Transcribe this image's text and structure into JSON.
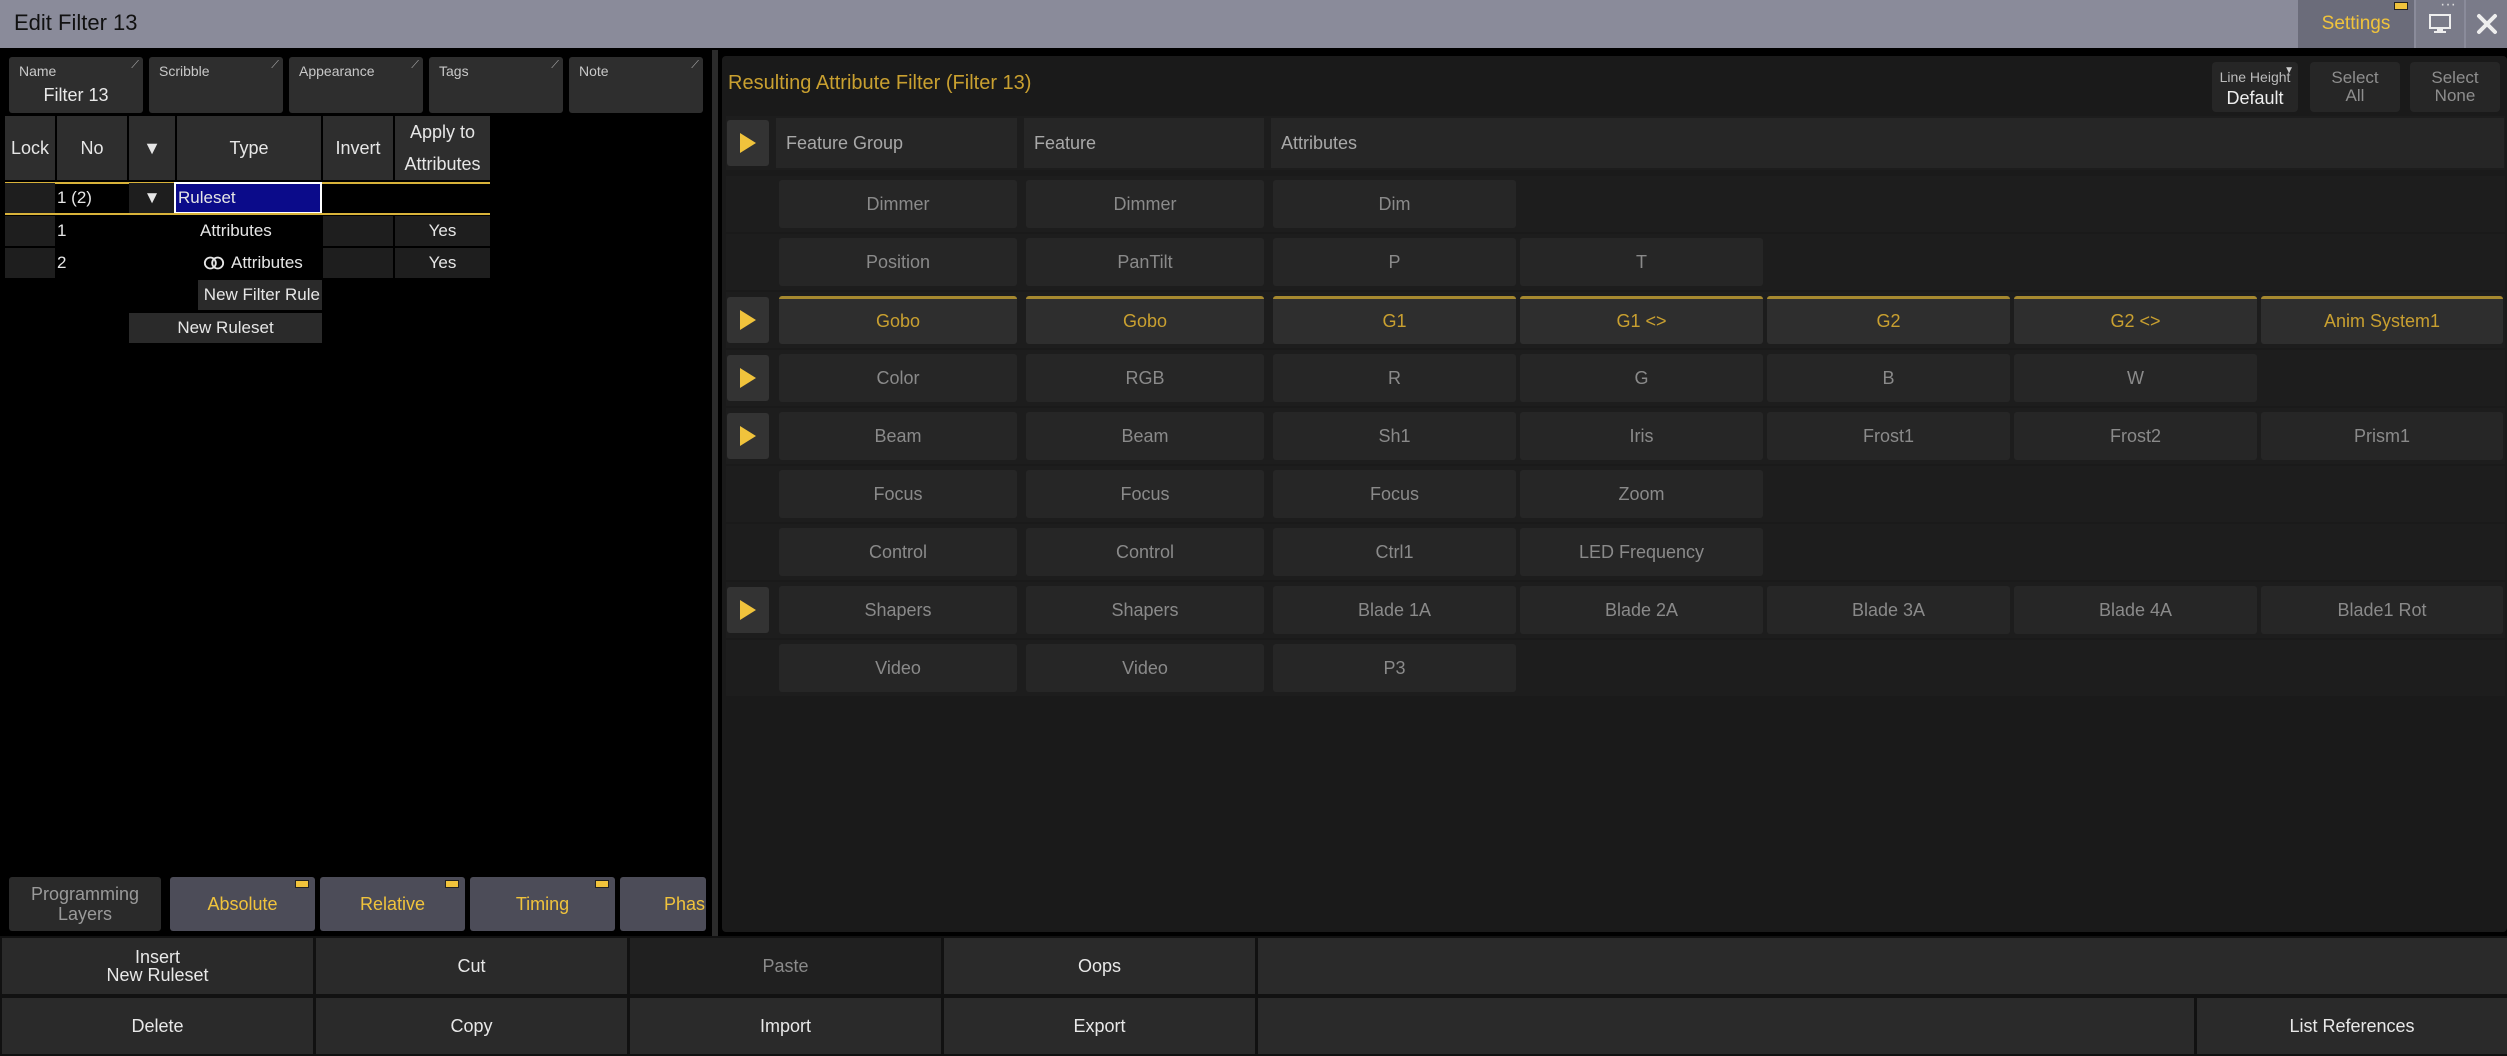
{
  "window": {
    "title": "Edit Filter 13",
    "settings_label": "Settings"
  },
  "properties": [
    {
      "label": "Name",
      "value": "Filter 13"
    },
    {
      "label": "Scribble",
      "value": ""
    },
    {
      "label": "Appearance",
      "value": ""
    },
    {
      "label": "Tags",
      "value": ""
    },
    {
      "label": "Note",
      "value": ""
    }
  ],
  "rule_table": {
    "headers": {
      "lock": "Lock",
      "no": "No",
      "sort": "▼",
      "type": "Type",
      "invert": "Invert",
      "apply_1": "Apply to",
      "apply_2": "Attributes"
    },
    "ruleset_row": {
      "no": "1 (2)",
      "arrow": "▼",
      "type": "Ruleset"
    },
    "rows": [
      {
        "no": "1",
        "type": "Attributes",
        "apply": "Yes"
      },
      {
        "no": "2",
        "type": "Attributes",
        "apply": "Yes"
      }
    ],
    "new_filter_rule": "New Filter Rule",
    "new_ruleset": "New Ruleset"
  },
  "bottom_tabs": [
    {
      "label_1": "Programming",
      "label_2": "Layers"
    },
    {
      "label": "Absolute"
    },
    {
      "label": "Relative"
    },
    {
      "label": "Timing"
    },
    {
      "label": "Phas"
    }
  ],
  "result": {
    "title": "Resulting Attribute Filter (Filter 13)",
    "line_height_label": "Line Height",
    "line_height_value": "Default",
    "select_all_1": "Select",
    "select_all_2": "All",
    "select_none_1": "Select",
    "select_none_2": "None",
    "columns": [
      "Feature Group",
      "Feature",
      "Attributes"
    ],
    "rows": [
      {
        "group": "Dimmer",
        "feature": "Dimmer",
        "attributes": [
          "Dim"
        ],
        "expand": false,
        "highlight": false
      },
      {
        "group": "Position",
        "feature": "PanTilt",
        "attributes": [
          "P",
          "T"
        ],
        "expand": false,
        "highlight": false
      },
      {
        "group": "Gobo",
        "feature": "Gobo",
        "attributes": [
          "G1",
          "G1 <>",
          "G2",
          "G2 <>",
          "Anim System1"
        ],
        "expand": true,
        "highlight": true
      },
      {
        "group": "Color",
        "feature": "RGB",
        "attributes": [
          "R",
          "G",
          "B",
          "W"
        ],
        "expand": true,
        "highlight": false
      },
      {
        "group": "Beam",
        "feature": "Beam",
        "attributes": [
          "Sh1",
          "Iris",
          "Frost1",
          "Frost2",
          "Prism1"
        ],
        "expand": true,
        "highlight": false
      },
      {
        "group": "Focus",
        "feature": "Focus",
        "attributes": [
          "Focus",
          "Zoom"
        ],
        "expand": false,
        "highlight": false
      },
      {
        "group": "Control",
        "feature": "Control",
        "attributes": [
          "Ctrl1",
          "LED Frequency"
        ],
        "expand": false,
        "highlight": false
      },
      {
        "group": "Shapers",
        "feature": "Shapers",
        "attributes": [
          "Blade 1A",
          "Blade 2A",
          "Blade 3A",
          "Blade 4A",
          "Blade1 Rot"
        ],
        "expand": true,
        "highlight": false
      },
      {
        "group": "Video",
        "feature": "Video",
        "attributes": [
          "P3"
        ],
        "expand": false,
        "highlight": false
      }
    ]
  },
  "commands": {
    "insert_1": "Insert",
    "insert_2": "New Ruleset",
    "cut": "Cut",
    "paste": "Paste",
    "oops": "Oops",
    "delete": "Delete",
    "copy": "Copy",
    "import": "Import",
    "export": "Export",
    "list_references": "List References"
  },
  "colors": {
    "accent": "#f0c33c",
    "title_text": "#c9a030",
    "selection": "#0b0b8a"
  }
}
